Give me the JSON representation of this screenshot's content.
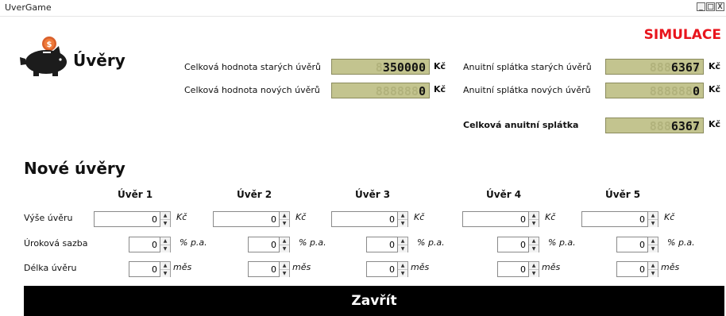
{
  "window": {
    "title": "UverGame",
    "minimize": "_",
    "maximize": "□",
    "close": "X"
  },
  "mode_badge": "SIMULACE",
  "header": {
    "title": "Úvěry",
    "logo_icon": "piggy-bank-icon"
  },
  "summary": {
    "old_total": {
      "label": "Celková hodnota starých úvěrů",
      "value": "350000",
      "ghost": "8888888",
      "unit": "Kč"
    },
    "new_total": {
      "label": "Celková hodnota nových úvěrů",
      "value": "0",
      "ghost": "8888888",
      "unit": "Kč"
    },
    "old_annuity": {
      "label": "Anuitní splátka starých úvěrů",
      "value": "6367",
      "ghost": "8888888",
      "unit": "Kč"
    },
    "new_annuity": {
      "label": "Anuitní splátka nových úvěrů",
      "value": "0",
      "ghost": "8888888",
      "unit": "Kč"
    },
    "total_annuity": {
      "label": "Celková anuitní splátka",
      "value": "6367",
      "ghost": "8888888",
      "unit": "Kč"
    }
  },
  "new_loans": {
    "title": "Nové úvěry",
    "columns": [
      "Úvěr 1",
      "Úvěr 2",
      "Úvěr 3",
      "Úvěr 4",
      "Úvěr 5"
    ],
    "rows": {
      "amount": {
        "label": "Výše úvěru",
        "unit": "Kč",
        "values": [
          "0",
          "0",
          "0",
          "0",
          "0"
        ]
      },
      "rate": {
        "label": "Úroková sazba",
        "unit": "% p.a.",
        "values": [
          "0",
          "0",
          "0",
          "0",
          "0"
        ]
      },
      "term": {
        "label": "Délka úvěru",
        "unit": "měs",
        "values": [
          "0",
          "0",
          "0",
          "0",
          "0"
        ]
      }
    }
  },
  "close_button": "Zavřít",
  "colors": {
    "accent": "#e8141c",
    "lcd_bg": "#c3c48f",
    "button_bg": "#000000"
  }
}
